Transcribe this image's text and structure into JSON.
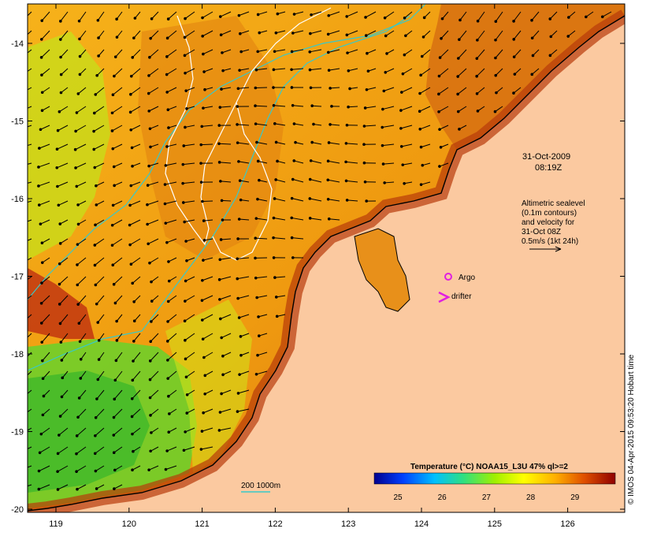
{
  "colors": {
    "land": "#fbc9a0",
    "coast": "#000000",
    "isobath": "#38c9c9",
    "contour": "#ffffff",
    "argo": "#e020e0",
    "drifter": "#e020e0"
  },
  "axes": {
    "x_ticks": [
      "119",
      "120",
      "121",
      "122",
      "123",
      "124",
      "125",
      "126"
    ],
    "y_ticks": [
      "-14",
      "-15",
      "-16",
      "-17",
      "-18",
      "-19",
      "-20"
    ]
  },
  "annotations": {
    "date": "31-Oct-2009",
    "time": "08:19Z",
    "alt_line1": "Altimetric sealevel",
    "alt_line2": "(0.1m contours)",
    "alt_line3": "and velocity for",
    "alt_line4": "31-Oct 08Z",
    "alt_line5": "0.5m/s (1kt 24h)",
    "argo": "Argo",
    "drifter": "drifter",
    "isobath_label": "200  1000m"
  },
  "colorbar": {
    "title": "Temperature (°C) NOAA15_L3U 47% ql>=2",
    "ticks": [
      "25",
      "26",
      "27",
      "28",
      "29"
    ]
  },
  "credit": "© IMOS 04-Apr-2015 09:53:20 Hobart time"
}
